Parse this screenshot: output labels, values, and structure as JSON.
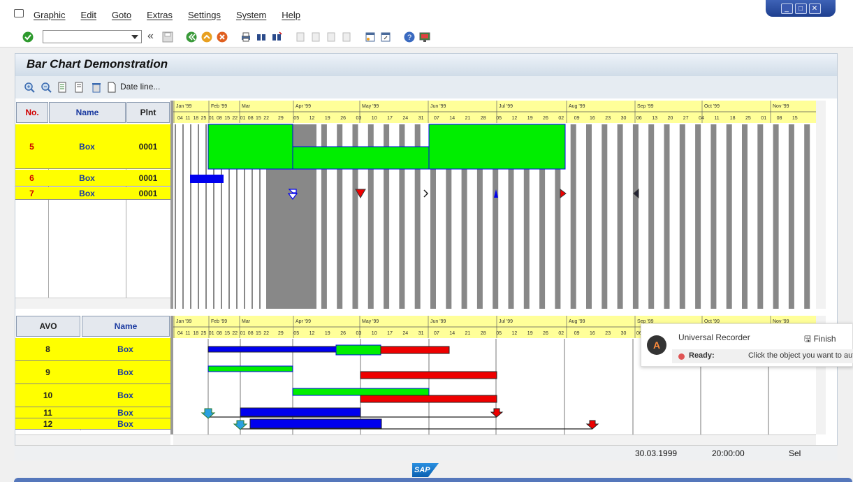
{
  "menu": {
    "items": [
      "Graphic",
      "Edit",
      "Goto",
      "Extras",
      "Settings",
      "System",
      "Help"
    ]
  },
  "window_controls": [
    "_",
    "□",
    "✕"
  ],
  "toolbar": {
    "command_value": "",
    "back_label": "«"
  },
  "panel": {
    "title": "Bar Chart Demonstration",
    "date_line_label": "Date line..."
  },
  "top_grid": {
    "headers": {
      "no": "No.",
      "name": "Name",
      "plnt": "Plnt"
    },
    "rows": [
      {
        "no": "5",
        "name": "Box",
        "plnt": "0001"
      },
      {
        "no": "6",
        "name": "Box",
        "plnt": "0001"
      },
      {
        "no": "7",
        "name": "Box",
        "plnt": "0001"
      }
    ]
  },
  "bottom_grid": {
    "headers": {
      "avo": "AVO",
      "name": "Name"
    },
    "rows": [
      {
        "avo": "8",
        "name": "Box"
      },
      {
        "avo": "9",
        "name": "Box"
      },
      {
        "avo": "10",
        "name": "Box"
      },
      {
        "avo": "11",
        "name": "Box"
      },
      {
        "avo": "12",
        "name": "Box"
      }
    ]
  },
  "timeline": {
    "months": [
      "Jan '99",
      "Feb '99",
      "Mar",
      "Apr '99",
      "May '99",
      "Jun '99",
      "Jul '99",
      "Aug '99",
      "Sep '99",
      "Oct '99",
      "Nov '99"
    ],
    "days": [
      "04",
      "11",
      "18",
      "25",
      "01",
      "08",
      "15",
      "22",
      "01",
      "08",
      "15",
      "22",
      "29",
      "05",
      "12",
      "19",
      "26",
      "03",
      "10",
      "17",
      "24",
      "31",
      "07",
      "14",
      "21",
      "28",
      "05",
      "12",
      "19",
      "26",
      "02",
      "09",
      "16",
      "23",
      "30",
      "06",
      "13",
      "20",
      "27",
      "04",
      "11",
      "18",
      "25",
      "01",
      "08",
      "15"
    ]
  },
  "colors": {
    "yellow": "#ffff00",
    "green": "#00ee00",
    "blue": "#0000ee",
    "red": "#ee0000",
    "grey": "#888888"
  },
  "status": {
    "date": "30.03.1999",
    "time": "20:00:00",
    "mode": "Sel"
  },
  "sap_logo": "SAP",
  "recorder": {
    "name": "Universal Recorder",
    "finish": "Finish",
    "status": "Ready:",
    "message": "Click the object you want to auto"
  }
}
